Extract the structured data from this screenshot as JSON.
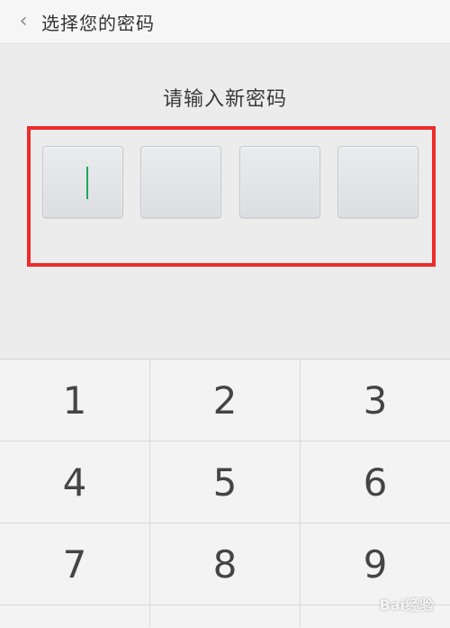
{
  "header": {
    "back_icon": "chevron-left-icon",
    "back_glyph": "‹",
    "title": "选择您的密码"
  },
  "prompt": "请输入新密码",
  "pin": {
    "length": 4,
    "entered": 0,
    "cursor_color": "#1aa85a"
  },
  "highlight_color": "#ee2b2b",
  "keypad": {
    "rows": [
      [
        "1",
        "2",
        "3"
      ],
      [
        "4",
        "5",
        "6"
      ],
      [
        "7",
        "8",
        "9"
      ]
    ]
  },
  "watermark": "Bai经验"
}
